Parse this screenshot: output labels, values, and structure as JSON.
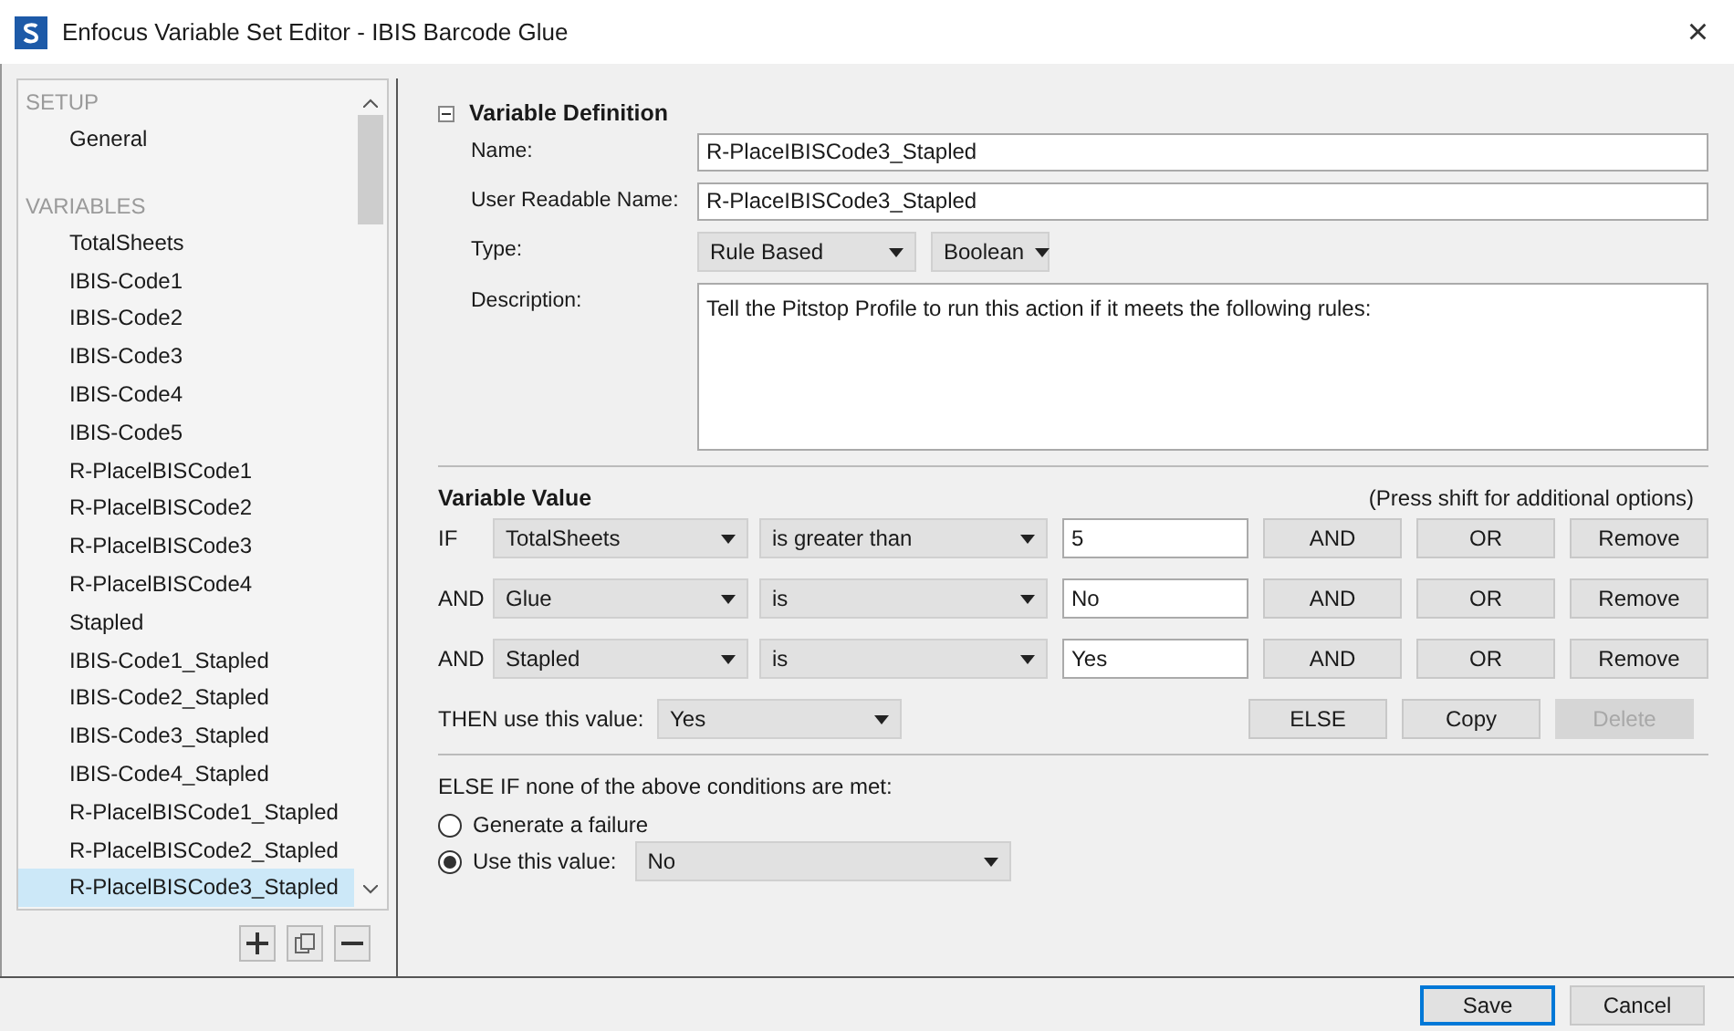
{
  "window": {
    "title": "Enfocus Variable Set Editor - IBIS Barcode Glue",
    "close": "×"
  },
  "sidebar": {
    "sections": [
      {
        "heading": "SETUP",
        "items": [
          {
            "label": "General",
            "selected": false
          }
        ]
      },
      {
        "heading": "VARIABLES",
        "items": [
          {
            "label": "TotalSheets",
            "selected": false
          },
          {
            "label": "IBIS-Code1",
            "selected": false
          },
          {
            "label": "IBIS-Code2",
            "selected": false
          },
          {
            "label": "IBIS-Code3",
            "selected": false
          },
          {
            "label": "IBIS-Code4",
            "selected": false
          },
          {
            "label": "IBIS-Code5",
            "selected": false
          },
          {
            "label": "R-PlacelBISCode1",
            "selected": false
          },
          {
            "label": "R-PlacelBISCode2",
            "selected": false
          },
          {
            "label": "R-PlacelBISCode3",
            "selected": false
          },
          {
            "label": "R-PlacelBISCode4",
            "selected": false
          },
          {
            "label": "Stapled",
            "selected": false
          },
          {
            "label": "IBIS-Code1_Stapled",
            "selected": false
          },
          {
            "label": "IBIS-Code2_Stapled",
            "selected": false
          },
          {
            "label": "IBIS-Code3_Stapled",
            "selected": false
          },
          {
            "label": "IBIS-Code4_Stapled",
            "selected": false
          },
          {
            "label": "R-PlacelBISCode1_Stapled",
            "selected": false
          },
          {
            "label": "R-PlacelBISCode2_Stapled",
            "selected": false
          },
          {
            "label": "R-PlacelBISCode3_Stapled",
            "selected": true
          }
        ]
      }
    ]
  },
  "definition": {
    "title": "Variable Definition",
    "expanded": true,
    "name": {
      "label": "Name:",
      "value": "R-PlaceIBISCode3_Stapled"
    },
    "readable_name": {
      "label": "User Readable Name:",
      "value": "R-PlaceIBISCode3_Stapled"
    },
    "type": {
      "label": "Type:",
      "value": "Rule Based",
      "subtype": "Boolean"
    },
    "description": {
      "label": "Description:",
      "value": "Tell the Pitstop Profile to run this action if it meets the following rules:"
    }
  },
  "value": {
    "title": "Variable Value",
    "hint": "(Press shift for additional options)",
    "conditions": [
      {
        "connector": "IF",
        "variable": "TotalSheets",
        "operator": "is greater than",
        "value": "5",
        "buttons": [
          "AND",
          "OR",
          "Remove"
        ]
      },
      {
        "connector": "AND",
        "variable": "Glue",
        "operator": "is",
        "value": "No",
        "buttons": [
          "AND",
          "OR",
          "Remove"
        ]
      },
      {
        "connector": "AND",
        "variable": "Stapled",
        "operator": "is",
        "value": "Yes",
        "buttons": [
          "AND",
          "OR",
          "Remove"
        ]
      }
    ],
    "then": {
      "label": "THEN use this value:",
      "value": "Yes"
    },
    "then_buttons": [
      {
        "label": "ELSE",
        "disabled": false
      },
      {
        "label": "Copy",
        "disabled": false
      },
      {
        "label": "Delete",
        "disabled": true
      }
    ],
    "else_label": "ELSE IF none of the above conditions are met:",
    "else_options": [
      {
        "label": "Generate a failure",
        "selected": false
      },
      {
        "label": "Use this value:",
        "selected": true,
        "value": "No"
      }
    ]
  },
  "footer": {
    "buttons": [
      "Save",
      "Cancel"
    ]
  }
}
